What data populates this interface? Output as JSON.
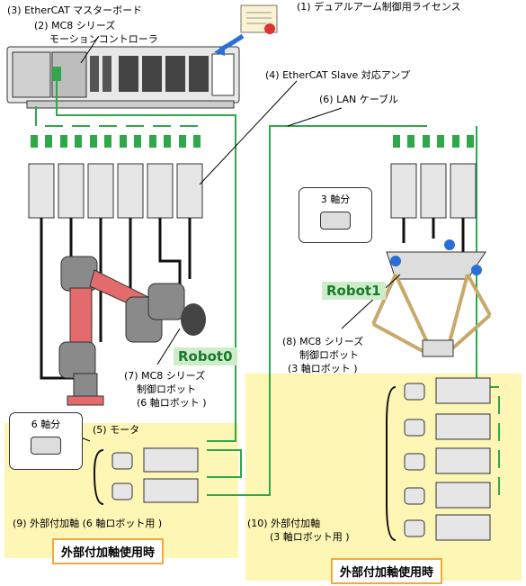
{
  "labels": {
    "license": "(1) デュアルアーム制御用ライセンス",
    "master_board": "(3) EtherCAT マスターボード",
    "controller_l1": "(2) MC8 シリーズ",
    "controller_l2": "モーションコントローラ",
    "slave_amp": "(4) EtherCAT Slave 対応アンプ",
    "lan_cable": "(6) LAN ケーブル",
    "robot0_l1": "(7) MC8 シリーズ",
    "robot0_l2": "制御ロボット",
    "robot0_l3": "(6 軸ロボット )",
    "robot1_l1": "(8) MC8 シリーズ",
    "robot1_l2": "制御ロボット",
    "robot1_l3": "(3 軸ロボット )",
    "motor": "(5) モータ",
    "ext9": "(9) 外部付加軸 (6 軸ロボット用 )",
    "ext10_l1": "(10) 外部付加軸",
    "ext10_l2": "(3 軸ロボット用 )"
  },
  "robots": {
    "robot0": "Robot0",
    "robot1": "Robot1"
  },
  "axis_boxes": {
    "six": "6 軸分",
    "three": "3 軸分"
  },
  "callouts": {
    "left": "外部付加軸使用時",
    "right": "外部付加軸使用時"
  },
  "colors": {
    "cable_green": "#2ea84a",
    "highlight_yellow": "#fdf6b4",
    "callout_border": "#f2a93b",
    "robot_pink": "#e36b6b",
    "robot_gray": "#8a8a8a",
    "accent_blue": "#2a6fd6"
  }
}
